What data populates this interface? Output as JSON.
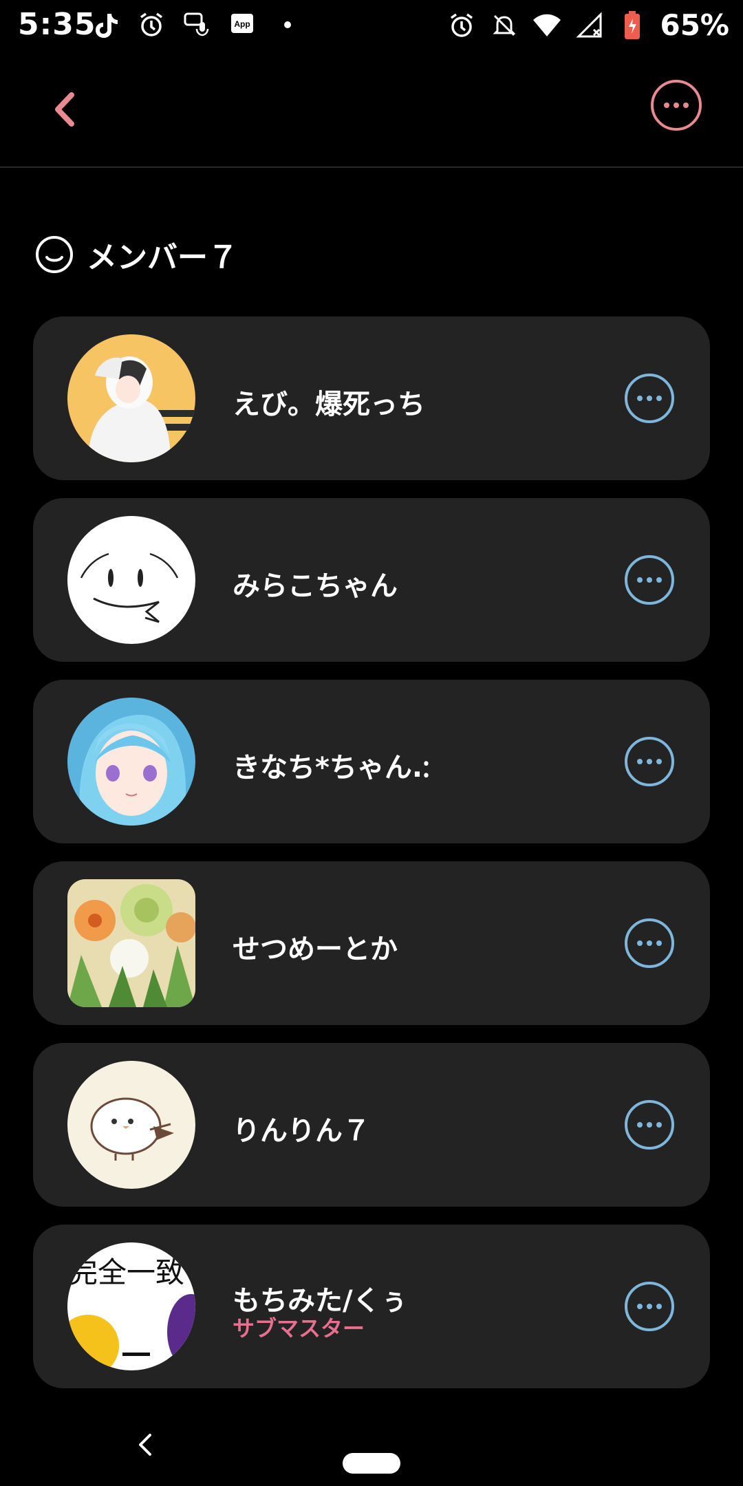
{
  "status_bar": {
    "time": "5:35",
    "battery": "65%",
    "app_badge": "App"
  },
  "section": {
    "title": "メンバー７"
  },
  "members": [
    {
      "name": "えび。爆死っち"
    },
    {
      "name": "みらこちゃん"
    },
    {
      "name": "きなち*ちゃん.ᱺ"
    },
    {
      "name": "せつめーとか"
    },
    {
      "name": "りんりん７"
    },
    {
      "name": "もちみた/くぅ",
      "role": "サブマスター",
      "avatar_text": "完全一致"
    }
  ],
  "colors": {
    "accent_pink": "#e98a93",
    "more_blue": "#7fb6dc",
    "role_pink": "#e96f8f",
    "card_bg": "#232323"
  }
}
